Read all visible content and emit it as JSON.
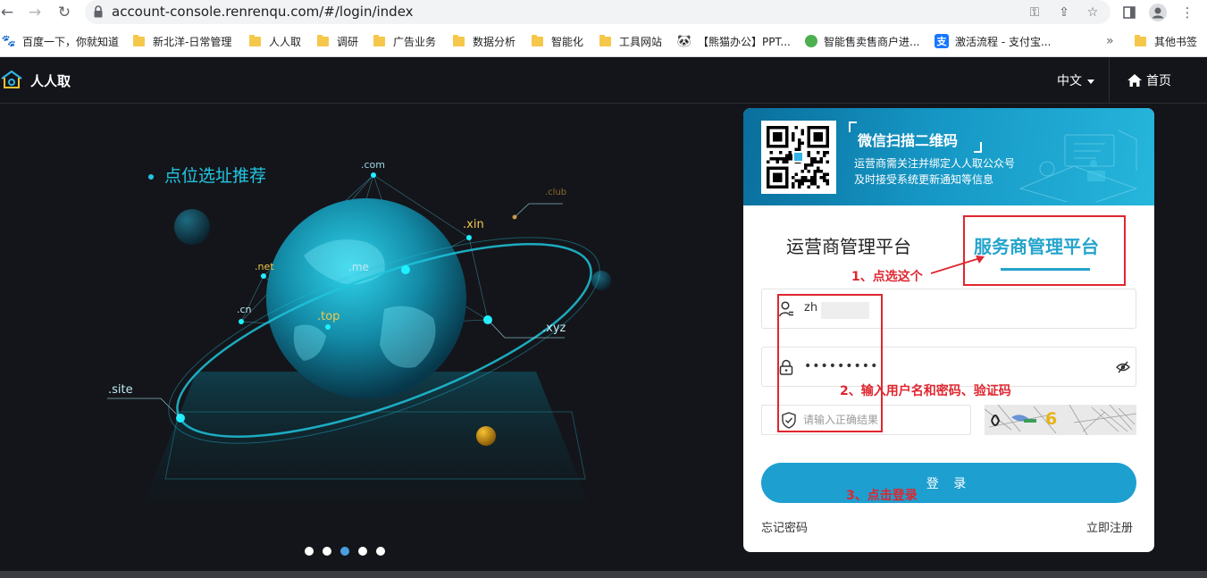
{
  "browser": {
    "url": "account-console.renrenqu.com/#/login/index",
    "bookmarks": [
      {
        "label": "百度一下，你就知道",
        "icon": "baidu-icon"
      },
      {
        "label": "新北洋-日常管理",
        "icon": "folder-icon"
      },
      {
        "label": "人人取",
        "icon": "folder-icon"
      },
      {
        "label": "调研",
        "icon": "folder-icon"
      },
      {
        "label": "广告业务",
        "icon": "folder-icon"
      },
      {
        "label": "数据分析",
        "icon": "folder-icon"
      },
      {
        "label": "智能化",
        "icon": "folder-icon"
      },
      {
        "label": "工具网站",
        "icon": "folder-icon"
      },
      {
        "label": "【熊猫办公】PPT...",
        "icon": "panda-icon"
      },
      {
        "label": "智能售卖售商户进...",
        "icon": "leaf-icon"
      },
      {
        "label": "激活流程 - 支付宝...",
        "icon": "alipay-icon"
      }
    ],
    "more_chevron": "»",
    "other_bookmarks": "其他书签"
  },
  "header": {
    "app_name": "人人取",
    "language": "中文",
    "home": "首页"
  },
  "hero": {
    "title": "点位选址推荐",
    "domain_labels": [
      ".com",
      ".club",
      ".xin",
      ".net",
      ".me",
      ".cn",
      ".top",
      ".xyz",
      ".site"
    ],
    "carousel": {
      "count": 5,
      "active_index": 2
    }
  },
  "login": {
    "banner_title": "微信扫描二维码",
    "banner_line1": "运营商需关注并绑定人人取公众号",
    "banner_line2": "及时接受系统更新通知等信息",
    "tab_operator": "运营商管理平台",
    "tab_service": "服务商管理平台",
    "active_tab": "服务商管理平台",
    "username_value": "zh",
    "password_mask": "•••••••••",
    "captcha_placeholder": "请输入正确结果",
    "captcha_visible_text": "6",
    "login_button": "登 录",
    "forgot_password": "忘记密码",
    "register": "立即注册"
  },
  "annotations": {
    "step1": "1、点选这个",
    "step2": "2、输入用户名和密码、验证码",
    "step3": "3、点击登录"
  },
  "colors": {
    "accent": "#25a4cc",
    "button": "#1d9fd0",
    "annotation": "#e0262f",
    "hero_cyan": "#21c6e3",
    "background": "#14151a"
  }
}
